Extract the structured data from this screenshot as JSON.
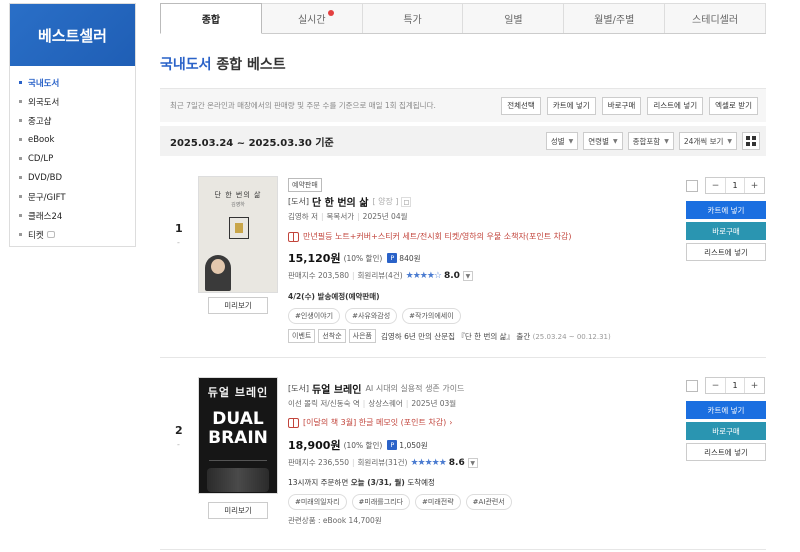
{
  "sidebar": {
    "header": "베스트셀러",
    "items": [
      {
        "label": "국내도서",
        "active": true
      },
      {
        "label": "외국도서"
      },
      {
        "label": "중고샵"
      },
      {
        "label": "eBook"
      },
      {
        "label": "CD/LP"
      },
      {
        "label": "DVD/BD"
      },
      {
        "label": "문구/GIFT"
      },
      {
        "label": "클래스24"
      },
      {
        "label": "티켓"
      }
    ]
  },
  "tabs": [
    "종합",
    "실시간",
    "특가",
    "일별",
    "월별/주별",
    "스테디셀러"
  ],
  "heading": {
    "blue": "국내도서",
    "rest": "종합 베스트"
  },
  "infobar": {
    "text": "최근 7일간 온라인과 매장에서의 판매량 및 주문 수를 기준으로 매일 1회 집계됩니다.",
    "buttons": [
      "전체선택",
      "카트에 넣기",
      "바로구매",
      "리스트에 넣기",
      "엑셀로 받기"
    ]
  },
  "datebar": {
    "range": "2025.03.24 ~ 2025.03.30 기준",
    "selects": [
      "성별",
      "연령별",
      "종합포함",
      "24개씩 보기"
    ]
  },
  "items": [
    {
      "rank": "1",
      "rank_sub": "-",
      "cover": {
        "title": "단 한 번의 삶",
        "author": "김영하"
      },
      "badge": "예약판매",
      "kind": "[도서]",
      "title": "단 한 번의 삶",
      "subtitle": "[ 양장 ]",
      "author": "김영하",
      "author_role": "저",
      "publisher": "복복서가",
      "date": "2025년 04월",
      "promo": "만년필등 노트+커버+스티커 세트/전시회 티켓/영하의 우물 소책자(포인트 차감)",
      "price": "15,120원",
      "discount": "(10% 할인)",
      "point_label": "P",
      "points": "840원",
      "sales": "판매지수 203,580",
      "reviews": "회원리뷰(4건)",
      "stars": "★★★★☆",
      "rating": "8.0",
      "shipping": "4/2(수) 발송예정(예약판매)",
      "tags": [
        "#인생이야기",
        "#사유와감성",
        "#작가의에세이"
      ],
      "events": [
        "이벤트",
        "선착순",
        "사은품"
      ],
      "event_text": "김영하 6년 만의 산문집 『단 한 번의 삶』 출간",
      "event_date": "(25.03.24 ~ 00.12.31)",
      "preview": "미리보기"
    },
    {
      "rank": "2",
      "rank_sub": "-",
      "cover": {
        "korean": "듀얼 브레인",
        "english": "DUAL BRAIN"
      },
      "kind": "[도서]",
      "title": "듀얼 브레인",
      "subtitle": "AI 시대의 실용적 생존 가이드",
      "author": "이선 몰릭",
      "author_role": "저/신동숙 역",
      "publisher": "상상스퀘어",
      "date": "2025년 03월",
      "promo": "[이달의 책 3월] 한글 메모잇 (포인트 차감)",
      "price": "18,900원",
      "discount": "(10% 할인)",
      "point_label": "P",
      "points": "1,050원",
      "sales": "판매지수 236,550",
      "reviews": "회원리뷰(31건)",
      "stars": "★★★★★",
      "rating": "8.6",
      "shipping_prefix": "13시까지 주문하면",
      "shipping_bold": "오늘 (3/31, 월)",
      "shipping_suffix": "도착예정",
      "tags": [
        "#미래의일자리",
        "#미래를그리다",
        "#미래전략",
        "#AI관련서"
      ],
      "related": "관련상품 : eBook 14,700원",
      "preview": "미리보기"
    }
  ],
  "actions": {
    "qty": "1",
    "cart": "카트에 넣기",
    "buy": "바로구매",
    "wish": "리스트에 넣기"
  },
  "colors": {
    "accent": "#2a62c8",
    "cart": "#1b6fe0",
    "buy": "#2a95b1",
    "promo": "#c2453c"
  }
}
